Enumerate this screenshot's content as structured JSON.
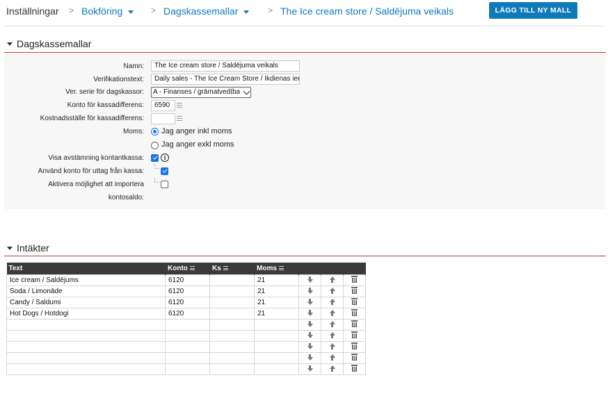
{
  "breadcrumb": {
    "root": "Inställningar",
    "items": [
      "Bokföring",
      "Dagskassemallar",
      "The Ice cream store / Saldējuma veikals"
    ],
    "separator": ">"
  },
  "actions": {
    "add_template": "LÄGG TILL NY MALL"
  },
  "colors": {
    "accent": "#0e7ab9",
    "section_line": "#c0392b",
    "table_header": "#3a3a3a"
  },
  "form": {
    "section_title": "Dagskassemallar",
    "name_label": "Namn:",
    "name_value": "The Ice cream store / Saldējuma veikals",
    "verification_label": "Verifikationstext:",
    "verification_value": "Daily sales - The Ice Cream Store  / Ikdienas ien",
    "series_label": "Ver. serie för dagskassor:",
    "series_value": "A - Finanses / grāmatvedība",
    "account_diff_label": "Konto för kassadifferens:",
    "account_diff_value": "6590",
    "cost_center_label": "Kostnadsställe för kassadifferens:",
    "cost_center_value": "",
    "vat_label": "Moms:",
    "vat_options": [
      {
        "label": "Jag anger inkl moms",
        "selected": true
      },
      {
        "label": "Jag anger exkl moms",
        "selected": false
      }
    ],
    "show_reconciliation_label": "Visa avstämning kontantkassa:",
    "show_reconciliation_checked": true,
    "use_account_label": "Använd konto för uttag från kassa:",
    "use_account_checked": true,
    "import_balance_label_1": "Aktivera möjlighet att importera",
    "import_balance_label_2": "kontosaldo:",
    "import_balance_checked": false
  },
  "income": {
    "section_title": "Intäkter",
    "columns": [
      "Text",
      "Konto",
      "Ks",
      "Moms"
    ],
    "rows": [
      {
        "text": "Ice cream / Saldējums",
        "konto": "6120",
        "ks": "",
        "moms": "21"
      },
      {
        "text": "Soda / Limonāde",
        "konto": "6120",
        "ks": "",
        "moms": "21"
      },
      {
        "text": "Candy / Saldumi",
        "konto": "6120",
        "ks": "",
        "moms": "21"
      },
      {
        "text": "Hot Dogs / Hotdogi",
        "konto": "6120",
        "ks": "",
        "moms": "21"
      },
      {
        "text": "",
        "konto": "",
        "ks": "",
        "moms": ""
      },
      {
        "text": "",
        "konto": "",
        "ks": "",
        "moms": ""
      },
      {
        "text": "",
        "konto": "",
        "ks": "",
        "moms": ""
      },
      {
        "text": "",
        "konto": "",
        "ks": "",
        "moms": ""
      },
      {
        "text": "",
        "konto": "",
        "ks": "",
        "moms": ""
      }
    ],
    "row_icons": [
      "arrow-down-icon",
      "arrow-up-icon",
      "trash-icon"
    ]
  }
}
